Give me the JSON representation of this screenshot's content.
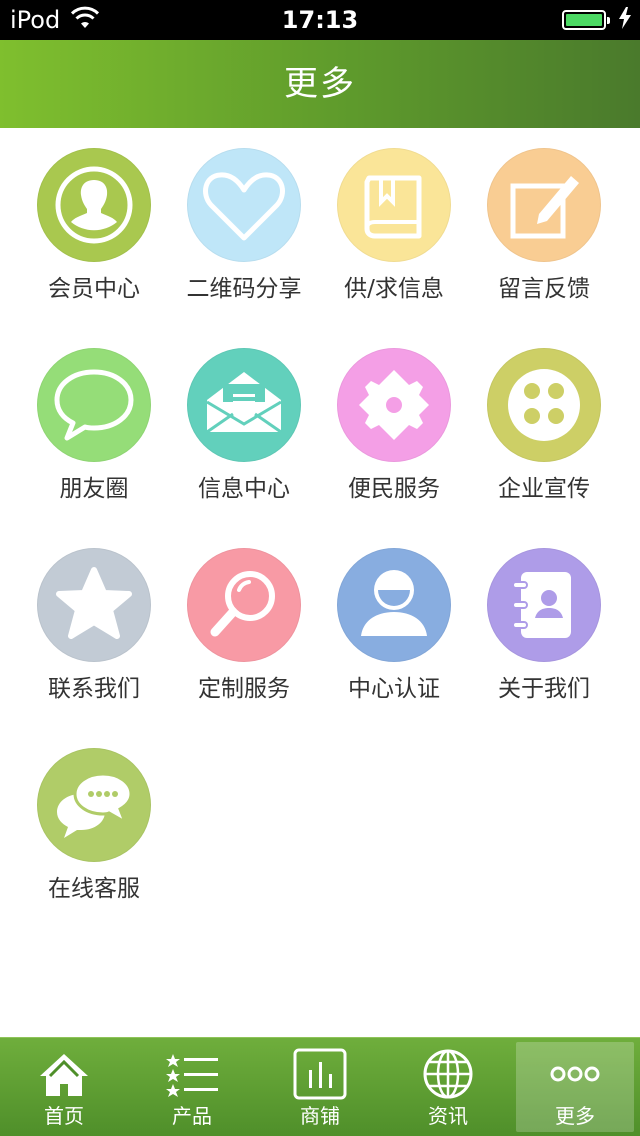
{
  "status_bar": {
    "carrier": "iPod",
    "time": "17:13",
    "wifi_icon": "wifi-icon",
    "battery_icon": "battery-icon",
    "charging_icon": "charging-icon"
  },
  "nav": {
    "title": "更多"
  },
  "grid": {
    "items": [
      {
        "label": "会员中心",
        "icon": "member-icon",
        "color": "#a9c84f"
      },
      {
        "label": "二维码分享",
        "icon": "heart-icon",
        "color": "#a9dbf2"
      },
      {
        "label": "供/求信息",
        "icon": "book-icon",
        "color": "#f9df8a"
      },
      {
        "label": "留言反馈",
        "icon": "edit-icon",
        "color": "#f8c98c"
      },
      {
        "label": "朋友圈",
        "icon": "chat-bubble-icon",
        "color": "#8fdb6f"
      },
      {
        "label": "信息中心",
        "icon": "mail-icon",
        "color": "#5ccdb8"
      },
      {
        "label": "便民服务",
        "icon": "puzzle-icon",
        "color": "#f28fe0"
      },
      {
        "label": "企业宣传",
        "icon": "film-reel-icon",
        "color": "#c7c95a"
      },
      {
        "label": "联系我们",
        "icon": "star-icon",
        "color": "#b9c3cf"
      },
      {
        "label": "定制服务",
        "icon": "magnifier-icon",
        "color": "#f7919e"
      },
      {
        "label": "中心认证",
        "icon": "user-badge-icon",
        "color": "#7fa8dc"
      },
      {
        "label": "关于我们",
        "icon": "contacts-book-icon",
        "color": "#a593e6"
      },
      {
        "label": "在线客服",
        "icon": "chat-dots-icon",
        "color": "#abc960"
      }
    ]
  },
  "tabbar": {
    "tabs": [
      {
        "label": "首页",
        "icon": "home-icon"
      },
      {
        "label": "产品",
        "icon": "list-icon"
      },
      {
        "label": "商铺",
        "icon": "shop-icon"
      },
      {
        "label": "资讯",
        "icon": "globe-icon"
      },
      {
        "label": "更多",
        "icon": "more-icon",
        "active": true
      }
    ]
  }
}
